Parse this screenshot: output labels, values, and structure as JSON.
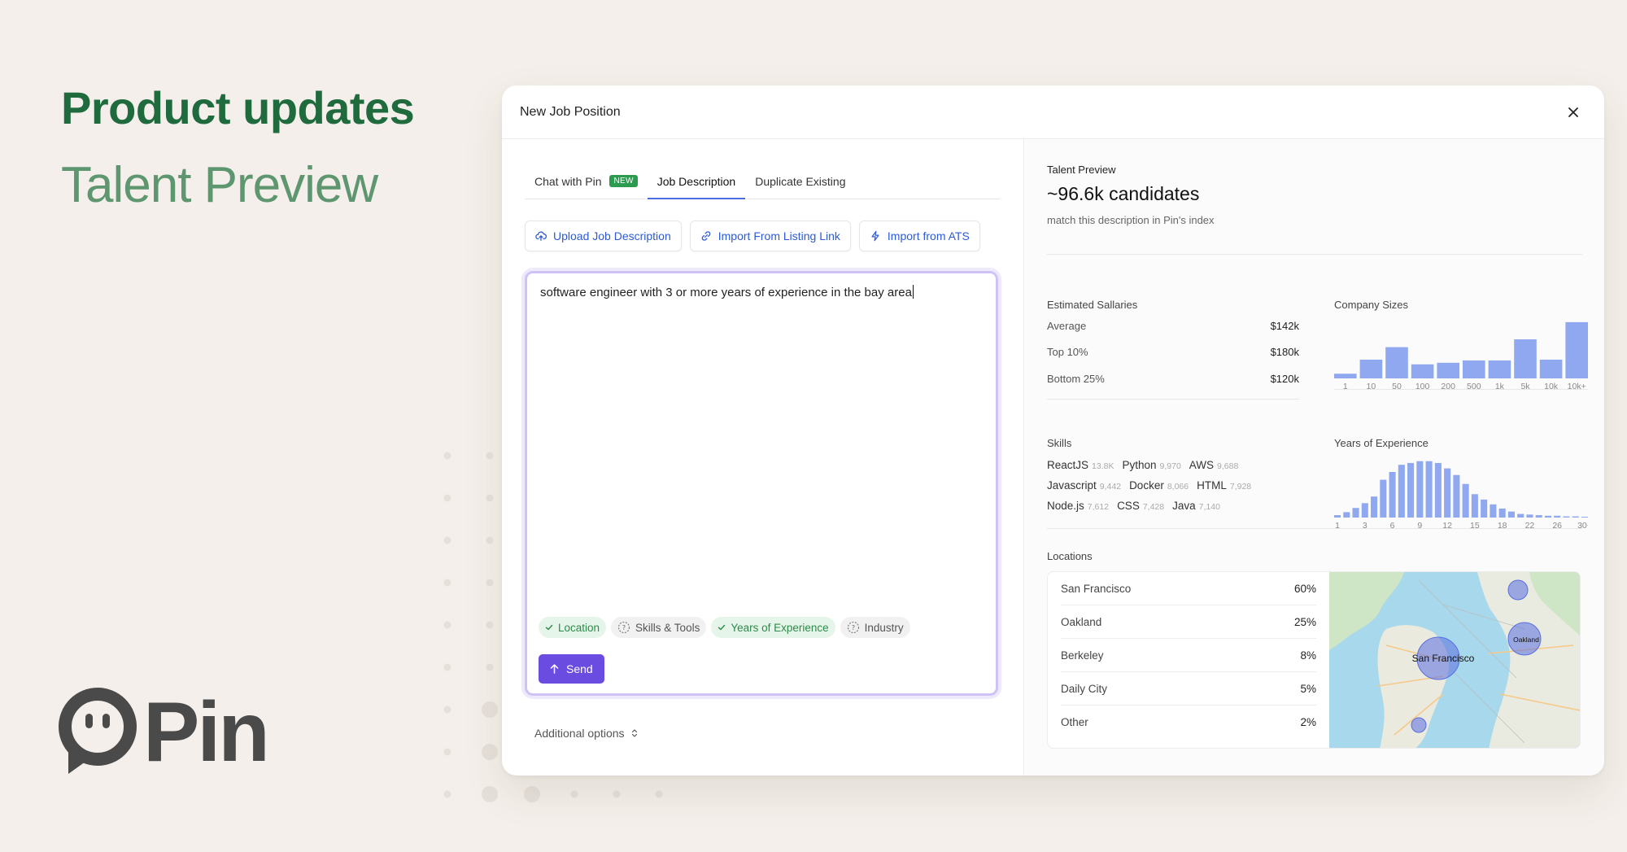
{
  "hero": {
    "title": "Product updates",
    "subtitle": "Talent Preview"
  },
  "logo": {
    "word": "Pin"
  },
  "modal": {
    "title": "New Job Position",
    "tabs": [
      {
        "label": "Chat with Pin",
        "badge": "NEW",
        "active": false
      },
      {
        "label": "Job Description",
        "active": true
      },
      {
        "label": "Duplicate Existing",
        "active": false
      }
    ],
    "actions": [
      {
        "label": "Upload Job Description",
        "icon": "cloud-upload-icon"
      },
      {
        "label": "Import From Listing Link",
        "icon": "link-icon"
      },
      {
        "label": "Import from ATS",
        "icon": "bolt-icon"
      }
    ],
    "composer": {
      "text": "software engineer with 3 or more years of experience in the bay area",
      "chips": [
        {
          "label": "Location",
          "done": true
        },
        {
          "label": "Skills & Tools",
          "done": false
        },
        {
          "label": "Years of Experience",
          "done": true
        },
        {
          "label": "Industry",
          "done": false
        }
      ],
      "send_label": "Send"
    },
    "additional_options": "Additional options"
  },
  "preview": {
    "label": "Talent Preview",
    "count": "~96.6k candidates",
    "desc": "match this description in Pin's index",
    "salaries": {
      "title": "Estimated Sallaries",
      "rows": [
        {
          "label": "Average",
          "value": "$142k"
        },
        {
          "label": "Top 10%",
          "value": "$180k"
        },
        {
          "label": "Bottom 25%",
          "value": "$120k"
        }
      ]
    },
    "skills": {
      "title": "Skills",
      "lines": [
        [
          {
            "name": "ReactJS",
            "count": "13.8K"
          },
          {
            "name": "Python",
            "count": "9,970"
          },
          {
            "name": "AWS",
            "count": "9,688"
          }
        ],
        [
          {
            "name": "Javascript",
            "count": "9,442"
          },
          {
            "name": "Docker",
            "count": "8,066"
          },
          {
            "name": "HTML",
            "count": "7,928"
          }
        ],
        [
          {
            "name": "Node.js",
            "count": "7,612"
          },
          {
            "name": "CSS",
            "count": "7,428"
          },
          {
            "name": "Java",
            "count": "7,140"
          }
        ]
      ]
    },
    "locations": {
      "title": "Locations",
      "rows": [
        {
          "label": "San Francisco",
          "value": "60%"
        },
        {
          "label": "Oakland",
          "value": "25%"
        },
        {
          "label": "Berkeley",
          "value": "8%"
        },
        {
          "label": "Daily City",
          "value": "5%"
        },
        {
          "label": "Other",
          "value": "2%"
        }
      ],
      "map_labels": {
        "sf": "San Francisco",
        "oakland": "Oakland"
      }
    },
    "accent_color": "#8fa8f0"
  },
  "chart_data": [
    {
      "type": "bar",
      "title": "Company Sizes",
      "categories": [
        "1",
        "",
        "10",
        "",
        "50",
        "",
        "100",
        "",
        "200",
        "",
        "500",
        "",
        "1k",
        "",
        "5k",
        "",
        "10k",
        "",
        "10k+"
      ],
      "tick_labels": [
        "1",
        "10",
        "50",
        "100",
        "200",
        "500",
        "1k",
        "5k",
        "10k",
        "10k+"
      ],
      "values": [
        6,
        24,
        40,
        18,
        20,
        23,
        23,
        50,
        24,
        72
      ],
      "ylim": [
        0,
        75
      ],
      "grid": false
    },
    {
      "type": "bar",
      "title": "Years of Experience",
      "tick_labels": [
        "1",
        "3",
        "6",
        "9",
        "12",
        "15",
        "18",
        "22",
        "26",
        "30+"
      ],
      "values": [
        4,
        9,
        16,
        24,
        35,
        63,
        76,
        88,
        91,
        94,
        94,
        91,
        82,
        71,
        56,
        39,
        30,
        22,
        15,
        10,
        6,
        5,
        4,
        3,
        3,
        2,
        2,
        1
      ],
      "ylim": [
        0,
        95
      ],
      "grid": false
    }
  ]
}
